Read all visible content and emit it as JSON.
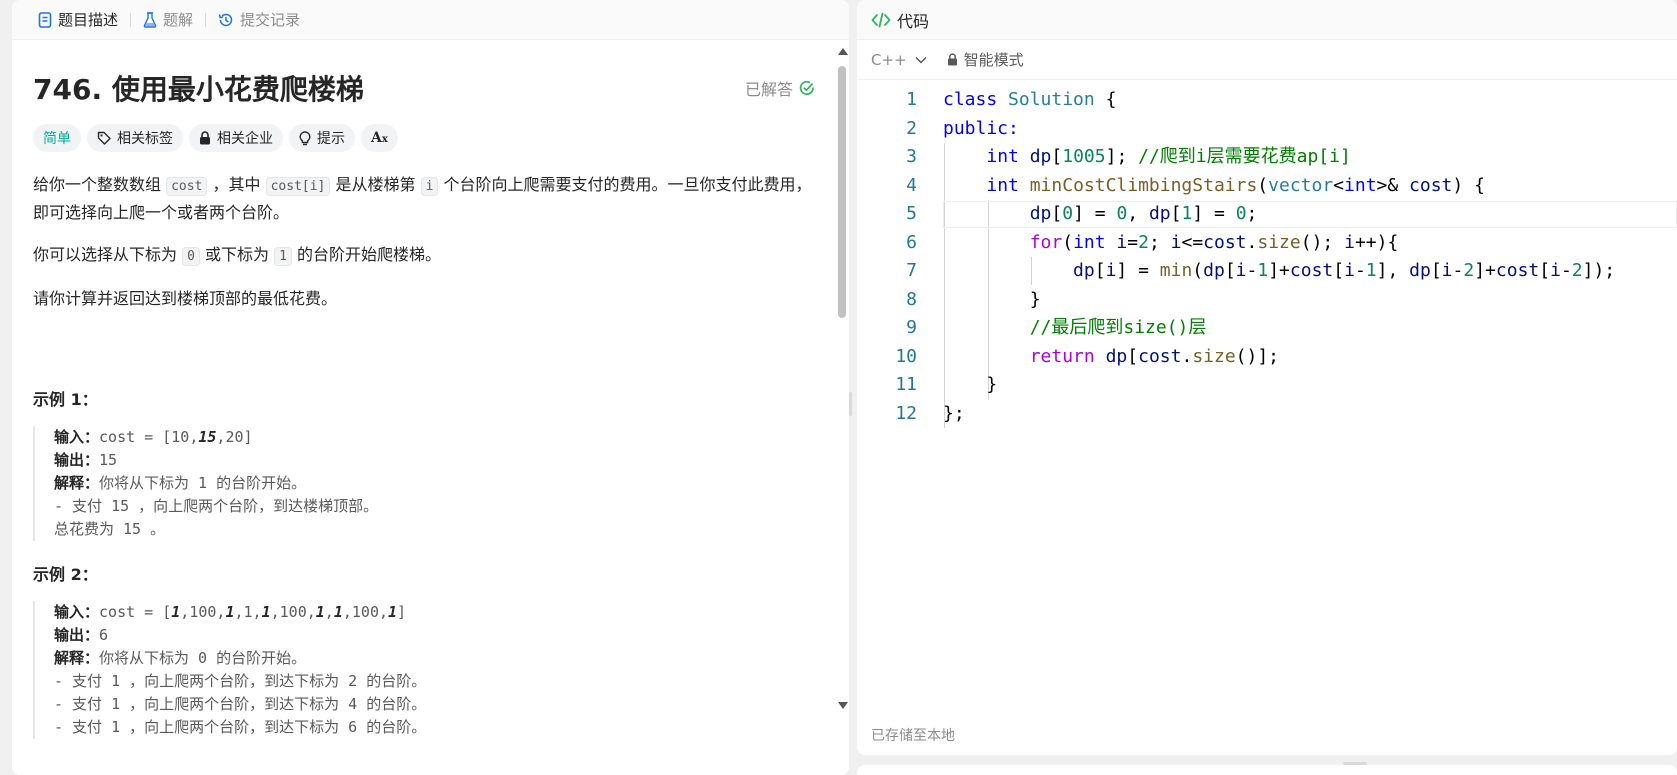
{
  "left_tabs": [
    {
      "label": "题目描述",
      "icon": "description-icon",
      "active": true
    },
    {
      "label": "题解",
      "icon": "flask-icon",
      "active": false
    },
    {
      "label": "提交记录",
      "icon": "history-icon",
      "active": false
    }
  ],
  "problem": {
    "title": "746. 使用最小花费爬楼梯",
    "status": "已解答",
    "tags": [
      {
        "label": "简单",
        "icon": ""
      },
      {
        "label": "相关标签",
        "icon": "tag-icon"
      },
      {
        "label": "相关企业",
        "icon": "lock-icon"
      },
      {
        "label": "提示",
        "icon": "bulb-icon"
      },
      {
        "label": "",
        "icon": "translate-icon"
      }
    ],
    "desc": {
      "p1_a": "给你一个整数数组 ",
      "p1_code1": "cost",
      "p1_b": " ，其中 ",
      "p1_code2": "cost[i]",
      "p1_c": " 是从楼梯第 ",
      "p1_code3": "i",
      "p1_d": " 个台阶向上爬需要支付的费用。一旦你支付此费用，即可选择向上爬一个或者两个台阶。",
      "p2_a": "你可以选择从下标为 ",
      "p2_code1": "0",
      "p2_b": " 或下标为 ",
      "p2_code2": "1",
      "p2_c": " 的台阶开始爬楼梯。",
      "p3": "请你计算并返回达到楼梯顶部的最低花费。"
    },
    "examples": [
      {
        "title": "示例 1：",
        "input_label": "输入：",
        "output_label": "输出：",
        "explain_label": "解释：",
        "output": "15",
        "explain": "你将从下标为 1 的台阶开始。",
        "lines": [
          "- 支付 15 ，向上爬两个台阶，到达楼梯顶部。",
          "总花费为 15 。"
        ]
      },
      {
        "title": "示例 2：",
        "input_label": "输入：",
        "output_label": "输出：",
        "explain_label": "解释：",
        "output": "6",
        "explain": "你将从下标为 0 的台阶开始。",
        "lines": [
          "- 支付 1 ，向上爬两个台阶，到达下标为 2 的台阶。",
          "- 支付 1 ，向上爬两个台阶，到达下标为 4 的台阶。",
          "- 支付 1 ，向上爬两个台阶，到达下标为 6 的台阶。"
        ]
      }
    ]
  },
  "code_panel": {
    "header": "代码",
    "language": "C++",
    "mode": "智能模式",
    "saved_status": "已存储至本地",
    "line_numbers": [
      "1",
      "2",
      "3",
      "4",
      "5",
      "6",
      "7",
      "8",
      "9",
      "10",
      "11",
      "12"
    ]
  },
  "colors": {
    "easy": "#00af9b",
    "solved_check": "#2db55d",
    "code_tab": "#2db55d"
  }
}
